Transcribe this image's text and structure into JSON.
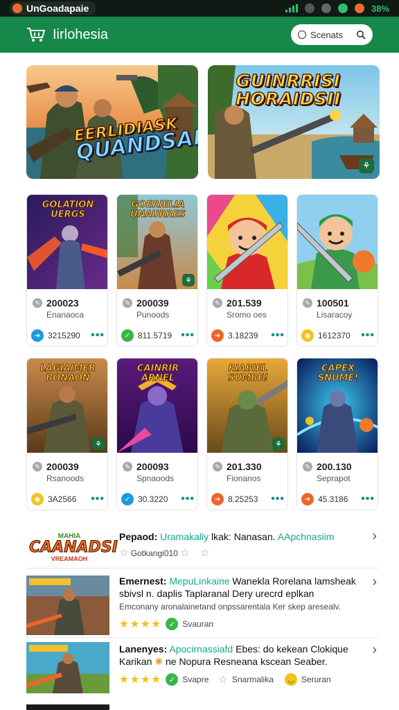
{
  "status": {
    "app_name": "UnGoadapaie",
    "battery": "38%",
    "colors": {
      "bar": "#0f1a14",
      "signal": "#2ebd6b"
    }
  },
  "header": {
    "title": "Iirlohesia",
    "search_label": "Scenats",
    "color": "#16884a"
  },
  "banners": [
    {
      "title_line1": "EERLIDIASK",
      "title_line2": "QUANDSAI"
    },
    {
      "title_line1": "GUINRRISI",
      "title_line2": "HORAIDSII"
    }
  ],
  "cards_row1": [
    {
      "art_title": "GOLATION UERGS",
      "price": "200023",
      "sub": "Enanaoca",
      "value": "3215290",
      "icon_color": "#1a9be0"
    },
    {
      "art_title": "GOERIELIA UNAURRES",
      "price": "200039",
      "sub": "Punoods",
      "value": "811.5719",
      "icon_color": "#3bb54a"
    },
    {
      "art_title": "",
      "price": "201.539",
      "sub": "Sromo oes",
      "value": "3.18239",
      "icon_color": "#f0642a"
    },
    {
      "art_title": "",
      "price": "100501",
      "sub": "Lisaracoy",
      "value": "1612370",
      "icon_color": "#f2c21a"
    }
  ],
  "cards_row2": [
    {
      "art_title": "LAGIAIMER BONAON",
      "price": "200039",
      "sub": "Rsanoods",
      "value": "3A2566",
      "icon_color": "#f2c21a"
    },
    {
      "art_title": "CAINRIR ARNEL",
      "price": "200093",
      "sub": "Spnaoods",
      "value": "30.3220",
      "icon_color": "#1a9be0"
    },
    {
      "art_title": "RIABIEL SUMBE!",
      "price": "201.330",
      "sub": "Fionanos",
      "value": "8.25253",
      "icon_color": "#f0642a"
    },
    {
      "art_title": "CAPEX SNUME!",
      "price": "200.130",
      "sub": "Seprapot",
      "value": "45.3186",
      "icon_color": "#f0642a"
    }
  ],
  "list": [
    {
      "logo_line1": "MAHIA",
      "logo_line2": "CAANADSI",
      "logo_line3": "VREAMAOH",
      "lead": "Pepaod:",
      "highlight": "Uramakaliy",
      "rest": " lkak: Nanasan. ",
      "highlight2": "AApchnasiim",
      "tag": "Gotkangi010"
    },
    {
      "lead": "Emernest:",
      "highlight": "MepuLinkaine",
      "rest": " Wanekla Rorelana lamsheak",
      "line2": "sbivsl n. daplis Taplaranal Dery urecrd eplkan",
      "line3": "Emconany aronalainetand onpssarentala Ker skep aresealv.",
      "meta": "Svauran"
    },
    {
      "lead": "Lanenyes:",
      "highlight": "Apocirnassiafd",
      "rest": " Ebes: do kekean Clokique",
      "line2": "Karikan",
      "line2b": "ne Nopura Resneana kscean Seaber.",
      "meta1": "Svapre",
      "meta2": "Snarmalika",
      "meta3": "Seruran"
    }
  ]
}
